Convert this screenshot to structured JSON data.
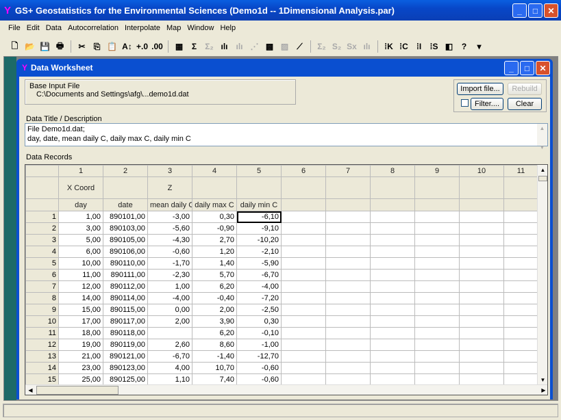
{
  "app": {
    "title": "GS+ Geostatistics for the Environmental Sciences (Demo1d -- 1Dimensional Analysis.par)"
  },
  "menu": [
    "File",
    "Edit",
    "Data",
    "Autocorrelation",
    "Interpolate",
    "Map",
    "Window",
    "Help"
  ],
  "toolbar": {
    "icons": [
      "new-icon",
      "open-icon",
      "save-icon",
      "print-icon",
      "|",
      "cut-icon",
      "copy-icon",
      "paste-icon",
      "sort-icon",
      "increase-decimal-icon",
      "decrease-decimal-icon",
      "|",
      "worksheet-icon",
      "sigma-icon",
      "sigma2-icon",
      "histogram-icon",
      "histogram2-icon",
      "scatter-icon",
      "map-icon",
      "map2-icon",
      "variogram-icon",
      "|",
      "sigma2b-icon",
      "s2-icon",
      "sx-icon",
      "hist3-icon",
      "|",
      "kriging-icon",
      "cokriging-icon",
      "idw-icon",
      "simulation-icon",
      "color-map-icon",
      "help-icon",
      "dropdown-icon"
    ],
    "glyphs": [
      "🗋",
      "📂",
      "💾",
      "🖶",
      "|",
      "✂",
      "⎘",
      "📋",
      "A↕",
      "+.0",
      ".00",
      "|",
      "▦",
      "Σ",
      "Σ₂",
      "ılı",
      "ılı",
      "⋰",
      "▩",
      "▨",
      "⟋",
      "|",
      "Σ₂",
      "S₂",
      "Sx",
      "ılı",
      "|",
      "⁞K",
      "⁞C",
      "⁞I",
      "⁞S",
      "◧",
      "?",
      "▾"
    ],
    "disabled": [
      14,
      16,
      17,
      19,
      22,
      23,
      24,
      25
    ]
  },
  "child": {
    "title": "Data Worksheet"
  },
  "base_input": {
    "label": "Base Input File",
    "path": "C:\\Documents and Settings\\afg\\...demo1d.dat"
  },
  "buttons": {
    "import": "Import file...",
    "rebuild": "Rebuild",
    "filter": "Filter....",
    "clear": "Clear"
  },
  "description": {
    "label": "Data Title / Description",
    "line1": "File Demo1d.dat;",
    "line2": "day, date, mean daily C, daily max C, daily min C"
  },
  "records": {
    "label": "Data Records",
    "col_numbers": [
      "1",
      "2",
      "3",
      "4",
      "5",
      "6",
      "7",
      "8",
      "9",
      "10",
      "11"
    ],
    "col_roles": [
      "X Coord",
      "",
      "Z",
      "",
      "",
      "",
      "",
      "",
      "",
      "",
      ""
    ],
    "col_names": [
      "day",
      "date",
      "mean daily C",
      "daily max C",
      "daily min C",
      "",
      "",
      "",
      "",
      "",
      ""
    ],
    "rows": [
      [
        "1",
        "1,00",
        "890101,00",
        "-3,00",
        "0,30",
        "-6,10"
      ],
      [
        "2",
        "3,00",
        "890103,00",
        "-5,60",
        "-0,90",
        "-9,10"
      ],
      [
        "3",
        "5,00",
        "890105,00",
        "-4,30",
        "2,70",
        "-10,20"
      ],
      [
        "4",
        "6,00",
        "890106,00",
        "-0,60",
        "1,20",
        "-2,10"
      ],
      [
        "5",
        "10,00",
        "890110,00",
        "-1,70",
        "1,40",
        "-5,90"
      ],
      [
        "6",
        "11,00",
        "890111,00",
        "-2,30",
        "5,70",
        "-6,70"
      ],
      [
        "7",
        "12,00",
        "890112,00",
        "1,00",
        "6,20",
        "-4,00"
      ],
      [
        "8",
        "14,00",
        "890114,00",
        "-4,00",
        "-0,40",
        "-7,20"
      ],
      [
        "9",
        "15,00",
        "890115,00",
        "0,00",
        "2,00",
        "-2,50"
      ],
      [
        "10",
        "17,00",
        "890117,00",
        "2,00",
        "3,90",
        "0,30"
      ],
      [
        "11",
        "18,00",
        "890118,00",
        "",
        "6,20",
        "-0,10"
      ],
      [
        "12",
        "19,00",
        "890119,00",
        "2,60",
        "8,60",
        "-1,00"
      ],
      [
        "13",
        "21,00",
        "890121,00",
        "-6,70",
        "-1,40",
        "-12,70"
      ],
      [
        "14",
        "23,00",
        "890123,00",
        "4,00",
        "10,70",
        "-0,60"
      ],
      [
        "15",
        "25,00",
        "890125,00",
        "1,10",
        "7,40",
        "-0,60"
      ]
    ]
  }
}
